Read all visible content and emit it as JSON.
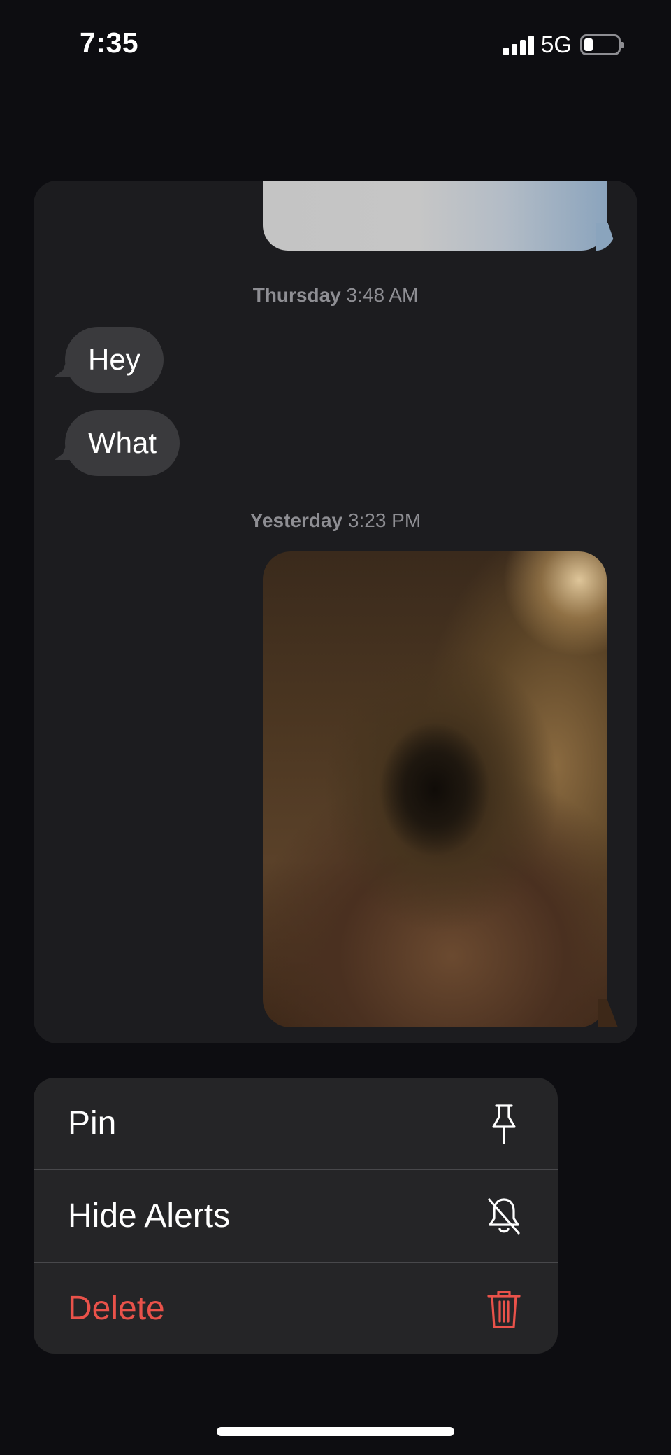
{
  "status_bar": {
    "time": "7:35",
    "network": "5G",
    "battery_level": 0.25
  },
  "conversation": {
    "timestamps": [
      {
        "day": "Thursday",
        "time": "3:48 AM"
      },
      {
        "day": "Yesterday",
        "time": "3:23 PM"
      }
    ],
    "incoming_messages": [
      "Hey",
      "What"
    ]
  },
  "context_menu": {
    "items": [
      {
        "label": "Pin",
        "icon": "pin-icon"
      },
      {
        "label": "Hide Alerts",
        "icon": "bell-slash-icon"
      },
      {
        "label": "Delete",
        "icon": "trash-icon"
      }
    ],
    "destructive_color": "#e9524a"
  },
  "colors": {
    "background": "#0d0d11",
    "preview_panel": "#1c1c1f",
    "incoming_bubble": "#3a3a3d",
    "menu_background": "#252527"
  }
}
